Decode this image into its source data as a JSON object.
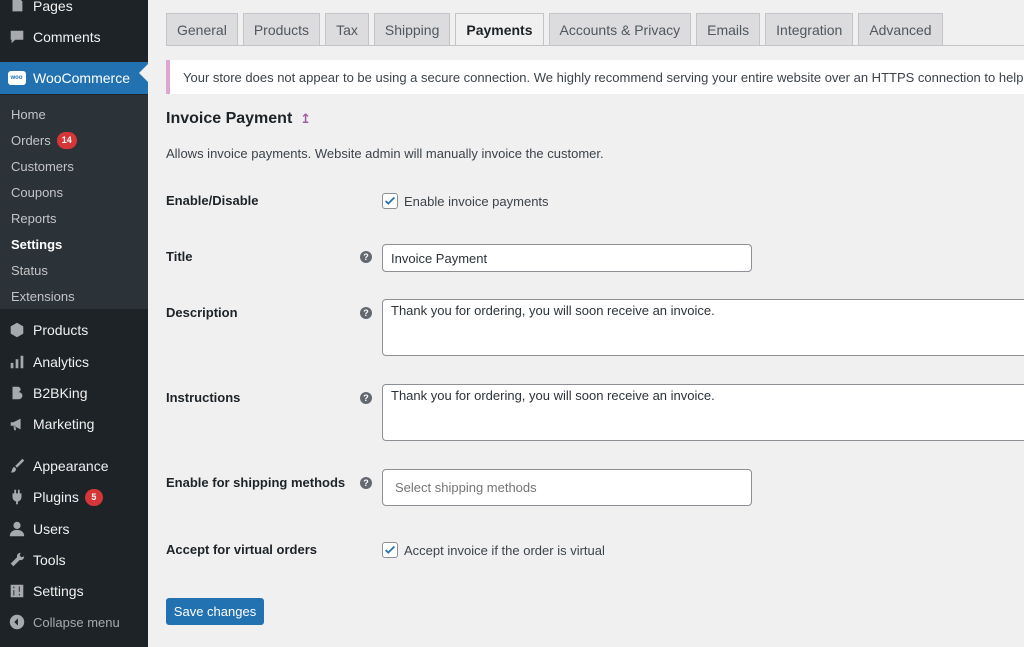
{
  "sidebar": {
    "pages": "Pages",
    "comments": "Comments",
    "woocommerce": "WooCommerce",
    "woo_logo_text": "woo",
    "submenu": [
      {
        "label": "Home"
      },
      {
        "label": "Orders",
        "badge": "14"
      },
      {
        "label": "Customers"
      },
      {
        "label": "Coupons"
      },
      {
        "label": "Reports"
      },
      {
        "label": "Settings"
      },
      {
        "label": "Status"
      },
      {
        "label": "Extensions"
      }
    ],
    "products": "Products",
    "analytics": "Analytics",
    "b2bking": "B2BKing",
    "marketing": "Marketing",
    "appearance": "Appearance",
    "plugins": "Plugins",
    "plugins_badge": "5",
    "users": "Users",
    "tools": "Tools",
    "settings": "Settings",
    "collapse": "Collapse menu"
  },
  "tabs": [
    "General",
    "Products",
    "Tax",
    "Shipping",
    "Payments",
    "Accounts & Privacy",
    "Emails",
    "Integration",
    "Advanced"
  ],
  "notice": "Your store does not appear to be using a secure connection. We highly recommend serving your entire website over an HTTPS connection to help keep",
  "page": {
    "title": "Invoice Payment",
    "up_icon": "↥",
    "description": "Allows invoice payments. Website admin will manually invoice the customer."
  },
  "form": {
    "enable_label": "Enable/Disable",
    "enable_checkbox_label": "Enable invoice payments",
    "title_label": "Title",
    "title_value": "Invoice Payment",
    "description_label": "Description",
    "description_value": "Thank you for ordering, you will soon receive an invoice.",
    "instructions_label": "Instructions",
    "instructions_value": "Thank you for ordering, you will soon receive an invoice.",
    "shipping_label": "Enable for shipping methods",
    "shipping_placeholder": "Select shipping methods",
    "virtual_label": "Accept for virtual orders",
    "virtual_checkbox_label": "Accept invoice if the order is virtual",
    "help": "?"
  },
  "save_label": "Save changes",
  "colors": {
    "accent": "#2271b1",
    "sidebar_bg": "#1d2327",
    "badge": "#d63638"
  }
}
